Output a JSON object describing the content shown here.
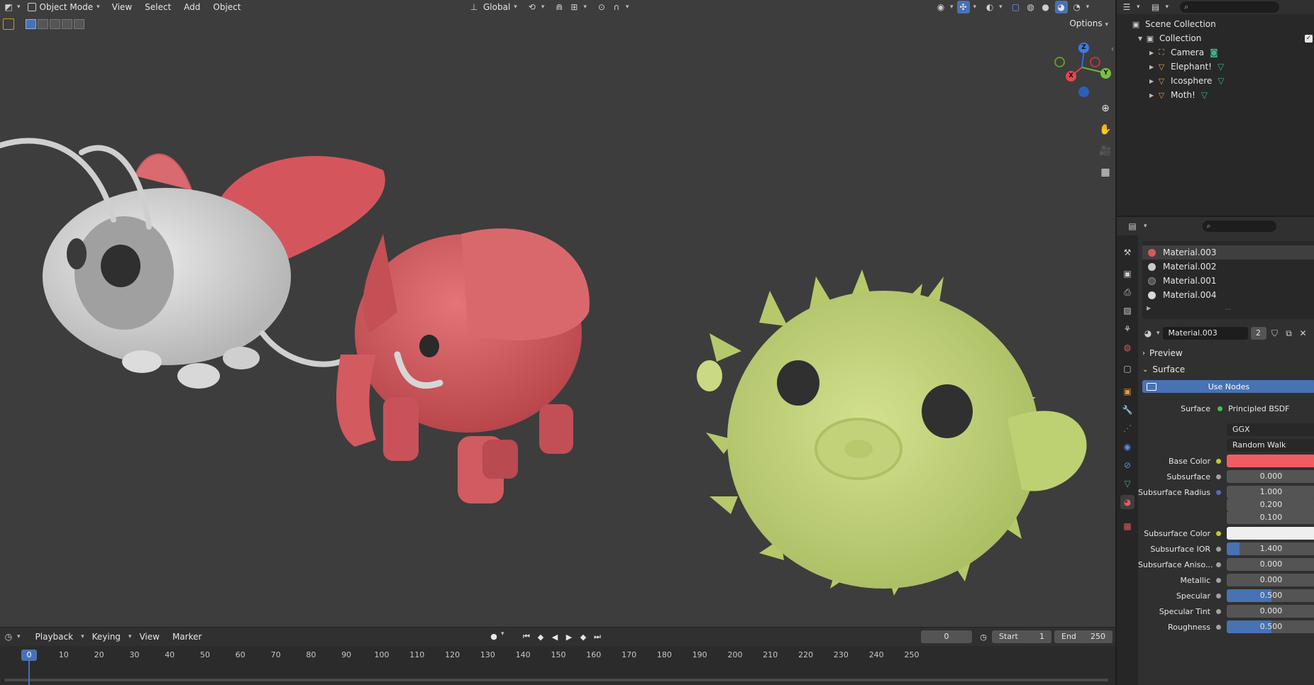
{
  "viewport": {
    "mode_label": "Object Mode",
    "menus": [
      "View",
      "Select",
      "Add",
      "Object"
    ],
    "transform_orientation": "Global",
    "options_label": "Options",
    "gizmo_axes": {
      "x": "X",
      "y": "Y",
      "z": "Z"
    }
  },
  "timeline": {
    "menus": [
      "Playback",
      "Keying",
      "View",
      "Marker"
    ],
    "current_frame": "0",
    "start_label": "Start",
    "start_value": "1",
    "end_label": "End",
    "end_value": "250",
    "frame_marker": "0",
    "ticks": [
      "10",
      "20",
      "30",
      "40",
      "50",
      "60",
      "70",
      "80",
      "90",
      "100",
      "110",
      "120",
      "130",
      "140",
      "150",
      "160",
      "170",
      "180",
      "190",
      "200",
      "210",
      "220",
      "230",
      "240",
      "250"
    ]
  },
  "outliner": {
    "scene_collection": "Scene Collection",
    "collection": "Collection",
    "objects": [
      {
        "name": "Camera",
        "icon": "camera-icon",
        "data_icon": "camera-data-icon"
      },
      {
        "name": "Elephant!",
        "icon": "mesh-object-icon",
        "data_icon": "mesh-data-icon"
      },
      {
        "name": "Icosphere",
        "icon": "mesh-object-icon",
        "data_icon": "mesh-data-icon"
      },
      {
        "name": "Moth!",
        "icon": "mesh-object-icon",
        "data_icon": "mesh-data-icon"
      }
    ]
  },
  "properties": {
    "materials": [
      {
        "name": "Material.003",
        "color": "#d9575c"
      },
      {
        "name": "Material.002",
        "color": "#c9c9c9"
      },
      {
        "name": "Material.001",
        "color": "#555555"
      },
      {
        "name": "Material.004",
        "color": "#d8d8d8"
      }
    ],
    "active_material": "Material.003",
    "users_count": "2",
    "preview_label": "Preview",
    "surface_panel_label": "Surface",
    "use_nodes_label": "Use Nodes",
    "surface_label": "Surface",
    "surface_shader": "Principled BSDF",
    "distribution": "GGX",
    "subsurface_method": "Random Walk",
    "fields": [
      {
        "label": "Base Color",
        "type": "color",
        "color": "#ef5d63",
        "socket": "#c7c729"
      },
      {
        "label": "Subsurface",
        "value": "0.000",
        "fill": 0,
        "socket": "#a1a1a1"
      },
      {
        "label": "Subsurface Radius",
        "value": "1.000",
        "fill": 0,
        "socket": "#6363c7"
      },
      {
        "label": "",
        "value": "0.200",
        "fill": 0,
        "socket": ""
      },
      {
        "label": "",
        "value": "0.100",
        "fill": 0,
        "socket": ""
      },
      {
        "label": "Subsurface Color",
        "type": "color",
        "color": "#efefef",
        "socket": "#c7c729"
      },
      {
        "label": "Subsurface IOR",
        "value": "1.400",
        "fill": 0.14,
        "socket": "#a1a1a1"
      },
      {
        "label": "Subsurface Aniso...",
        "value": "0.000",
        "fill": 0,
        "socket": "#a1a1a1"
      },
      {
        "label": "Metallic",
        "value": "0.000",
        "fill": 0,
        "socket": "#a1a1a1"
      },
      {
        "label": "Specular",
        "value": "0.500",
        "fill": 0.5,
        "socket": "#a1a1a1"
      },
      {
        "label": "Specular Tint",
        "value": "0.000",
        "fill": 0,
        "socket": "#a1a1a1"
      },
      {
        "label": "Roughness",
        "value": "0.500",
        "fill": 0.5,
        "socket": "#a1a1a1"
      }
    ]
  },
  "colors": {
    "accent": "#4772b3",
    "elephant": "#d9575c",
    "moth": "#d6d6d6",
    "puffer": "#c5d67a"
  }
}
